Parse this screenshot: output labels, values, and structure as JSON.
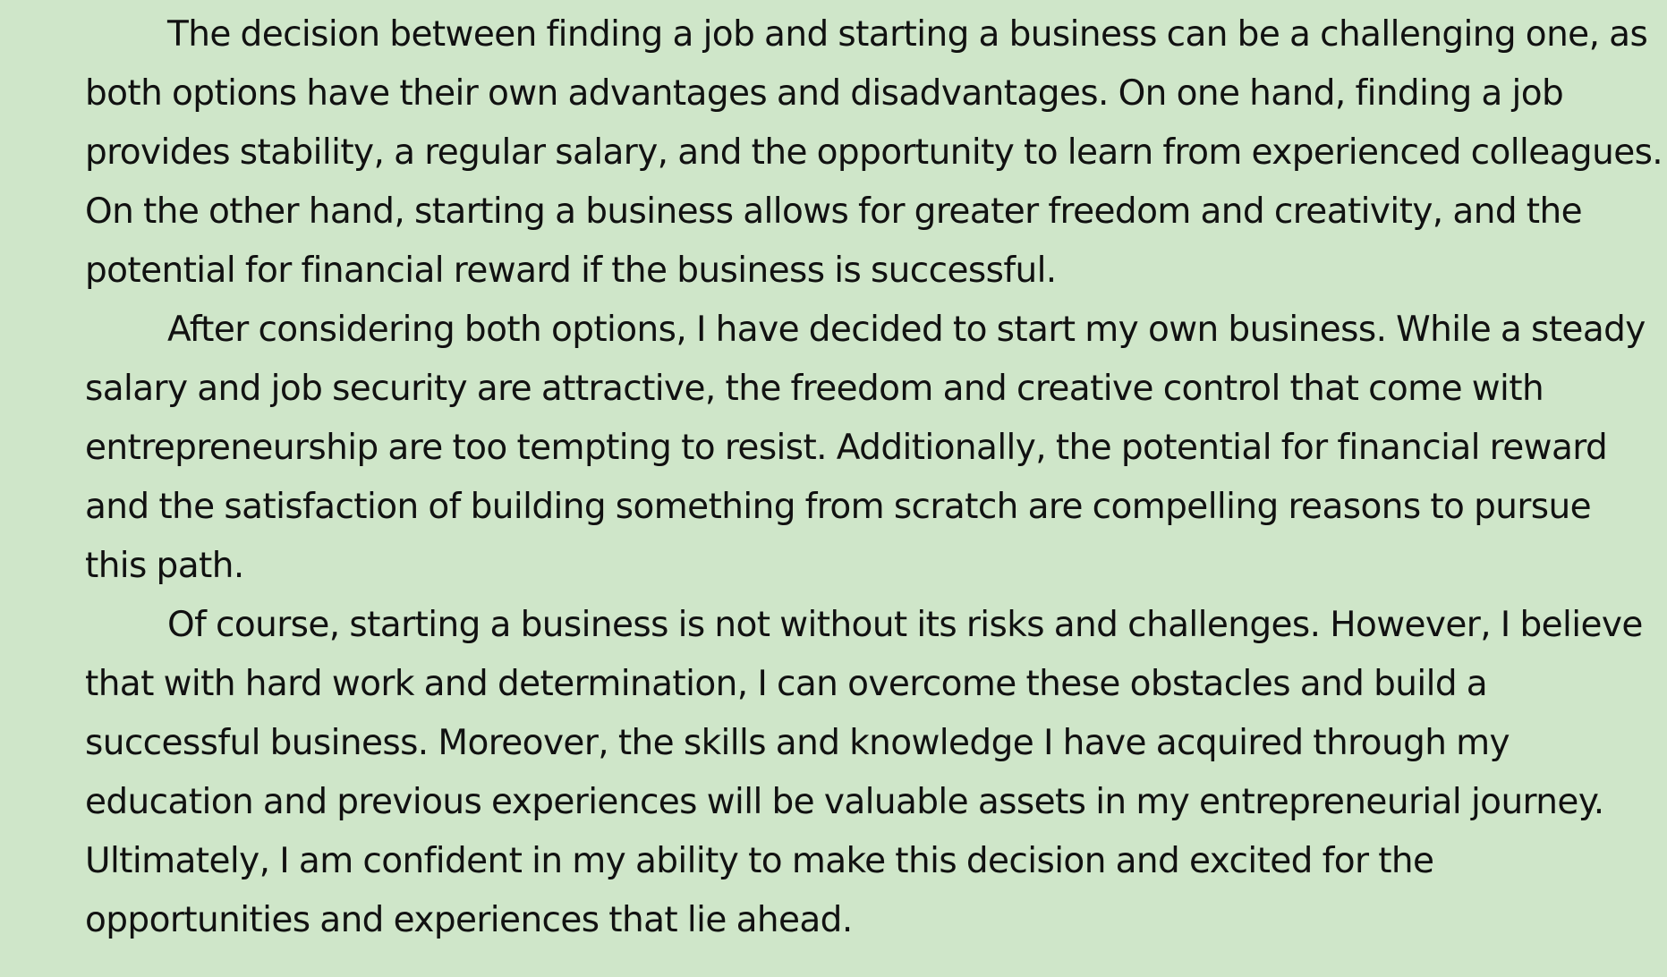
{
  "document": {
    "paragraphs": [
      {
        "lines": [
          "The decision between finding a job and starting a business can be a challenging one, as",
          "both options have their own advantages and disadvantages. On one hand, finding a job",
          "provides stability, a regular salary, and the opportunity to learn from experienced colleagues.",
          "On the other hand, starting a business allows for greater freedom and creativity, and the",
          "potential for financial reward if the business is successful."
        ]
      },
      {
        "lines": [
          "After considering both options, I have decided to start my own business. While a steady",
          "salary and job security are attractive, the freedom and creative control that come with",
          "entrepreneurship are too tempting to resist. Additionally, the potential for financial reward",
          "and the satisfaction of building something from scratch are compelling reasons to pursue",
          "this path."
        ]
      },
      {
        "lines": [
          "Of course, starting a business is not without its risks and challenges. However, I believe",
          "that with hard work and determination, I can overcome these obstacles and build a",
          "successful business. Moreover, the skills and knowledge I have acquired through my",
          "education and previous experiences will be valuable assets in my entrepreneurial journey.",
          "Ultimately, I am confident in my ability to make this decision and excited for the",
          "opportunities and experiences that lie ahead."
        ]
      }
    ]
  },
  "colors": {
    "background": "#cfe6c9",
    "text": "#111111"
  }
}
